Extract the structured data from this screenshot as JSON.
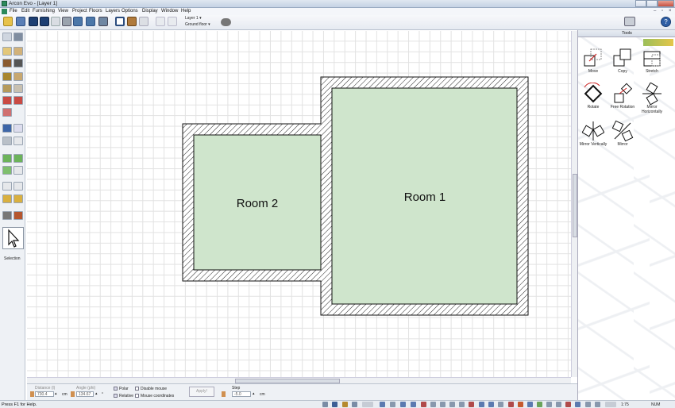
{
  "window": {
    "title": "Arcon Evo - [Layer 1]"
  },
  "menu": [
    "File",
    "Edit",
    "Furnishing",
    "View",
    "Project",
    "Floors",
    "Layers",
    "Options",
    "Display",
    "Window",
    "Help"
  ],
  "toolbar": {
    "layer": "Layer 1",
    "floor": "Ground floor"
  },
  "left_tools": {
    "selection_label": "Selection"
  },
  "canvas": {
    "rooms": [
      {
        "name": "Room 2",
        "fill": "#cfe5cc"
      },
      {
        "name": "Room 1",
        "fill": "#cfe5cc"
      }
    ]
  },
  "tools_panel": {
    "title": "Tools",
    "tools": [
      {
        "label": "Move",
        "icon": "move-icon"
      },
      {
        "label": "Copy",
        "icon": "copy-icon"
      },
      {
        "label": "Stretch",
        "icon": "stretch-icon"
      },
      {
        "label": "Rotate",
        "icon": "rotate-icon"
      },
      {
        "label": "Free Rotation",
        "icon": "free-rotation-icon"
      },
      {
        "label": "Mirror Horizontally",
        "icon": "mirror-horizontally-icon"
      },
      {
        "label": "Mirror Vertically",
        "icon": "mirror-vertically-icon"
      },
      {
        "label": "Mirror",
        "icon": "mirror-icon"
      }
    ]
  },
  "bottom": {
    "distance_label": "Distance (l)",
    "distance_value": "730.4",
    "distance_unit": "cm",
    "angle_label": "Angle (phi)",
    "angle_value": "134.67",
    "angle_unit": "°",
    "polar": "Polar",
    "relative": "Relative",
    "disable_mouse": "Disable mouse",
    "mouse_coordinates": "Mouse coordinates",
    "apply": "Apply!",
    "step_label": "Step",
    "step_value": "-5.0",
    "step_unit": "cm"
  },
  "status": {
    "text": "Press F1 for Help.",
    "scale": "1:75",
    "num": "NUM"
  },
  "colors": {
    "room_fill": "#cfe5cc",
    "wall_hatch": "#222222",
    "grid": "#e2e2e2"
  }
}
